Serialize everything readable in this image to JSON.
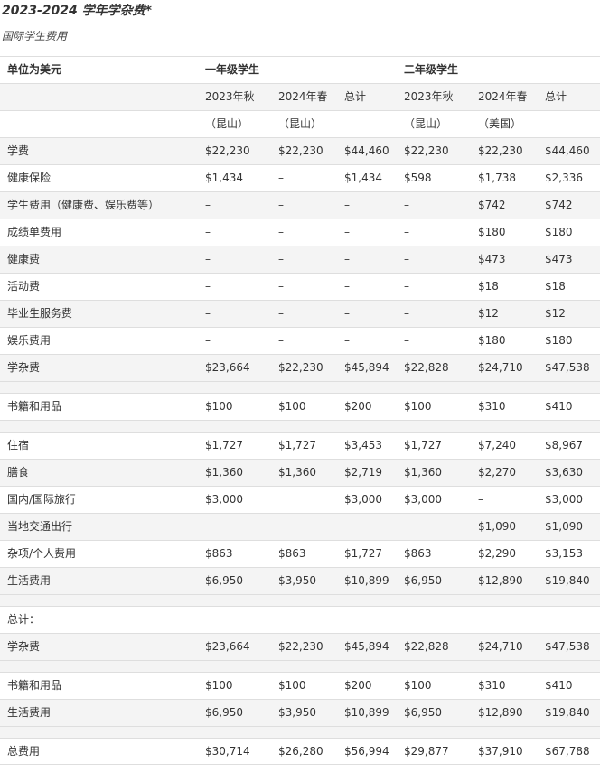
{
  "title": "2023-2024 学年学杂费*",
  "subtitle": "国际学生费用",
  "group_header": {
    "unit": "单位为美元",
    "year1": "一年级学生",
    "year2": "二年级学生"
  },
  "term_header": [
    "",
    "2023年秋",
    "2024年春",
    "总计",
    "2023年秋",
    "2024年春",
    "总计"
  ],
  "location_header": [
    "",
    "（昆山）",
    "（昆山）",
    "",
    "（昆山）",
    "（美国）",
    ""
  ],
  "rows": [
    {
      "label": "学费",
      "cells": [
        "$22,230",
        "$22,230",
        "$44,460",
        "$22,230",
        "$22,230",
        "$44,460"
      ]
    },
    {
      "label": "健康保险",
      "cells": [
        "$1,434",
        "–",
        "$1,434",
        "$598",
        "$1,738",
        "$2,336"
      ]
    },
    {
      "label": "学生费用（健康费、娱乐费等）",
      "cells": [
        "–",
        "–",
        "–",
        "–",
        "$742",
        "$742"
      ]
    },
    {
      "label": "成绩单费用",
      "cells": [
        "–",
        "–",
        "–",
        "–",
        "$180",
        "$180"
      ]
    },
    {
      "label": "健康费",
      "cells": [
        "–",
        "–",
        "–",
        "–",
        "$473",
        "$473"
      ]
    },
    {
      "label": "活动费",
      "cells": [
        "–",
        "–",
        "–",
        "–",
        "$18",
        "$18"
      ]
    },
    {
      "label": "毕业生服务费",
      "cells": [
        "–",
        "–",
        "–",
        "–",
        "$12",
        "$12"
      ]
    },
    {
      "label": "娱乐费用",
      "cells": [
        "–",
        "–",
        "–",
        "–",
        "$180",
        "$180"
      ]
    },
    {
      "label": "学杂费",
      "cells": [
        "$23,664",
        "$22,230",
        "$45,894",
        "$22,828",
        "$24,710",
        "$47,538"
      ]
    },
    {
      "label": "书籍和用品",
      "cells": [
        "$100",
        "$100",
        "$200",
        "$100",
        "$310",
        "$410"
      ]
    },
    {
      "label": "住宿",
      "cells": [
        "$1,727",
        "$1,727",
        "$3,453",
        "$1,727",
        "$7,240",
        "$8,967"
      ]
    },
    {
      "label": "膳食",
      "cells": [
        "$1,360",
        "$1,360",
        "$2,719",
        "$1,360",
        "$2,270",
        "$3,630"
      ]
    },
    {
      "label": "国内/国际旅行",
      "cells": [
        "$3,000",
        "",
        "$3,000",
        "$3,000",
        "–",
        "$3,000"
      ]
    },
    {
      "label": "当地交通出行",
      "cells": [
        "",
        "",
        "",
        "",
        "$1,090",
        "$1,090"
      ]
    },
    {
      "label": "杂项/个人费用",
      "cells": [
        "$863",
        "$863",
        "$1,727",
        "$863",
        "$2,290",
        "$3,153"
      ]
    },
    {
      "label": "生活费用",
      "cells": [
        "$6,950",
        "$3,950",
        "$10,899",
        "$6,950",
        "$12,890",
        "$19,840"
      ]
    },
    {
      "label": "总计：",
      "cells": [
        "",
        "",
        "",
        "",
        "",
        ""
      ]
    },
    {
      "label": "学杂费",
      "cells": [
        "$23,664",
        "$22,230",
        "$45,894",
        "$22,828",
        "$24,710",
        "$47,538"
      ]
    },
    {
      "label": "书籍和用品",
      "cells": [
        "$100",
        "$100",
        "$200",
        "$100",
        "$310",
        "$410"
      ]
    },
    {
      "label": "生活费用",
      "cells": [
        "$6,950",
        "$3,950",
        "$10,899",
        "$6,950",
        "$12,890",
        "$19,840"
      ]
    },
    {
      "label": "总费用",
      "cells": [
        "$30,714",
        "$26,280",
        "$56,994",
        "$29,877",
        "$37,910",
        "$67,788"
      ]
    }
  ]
}
